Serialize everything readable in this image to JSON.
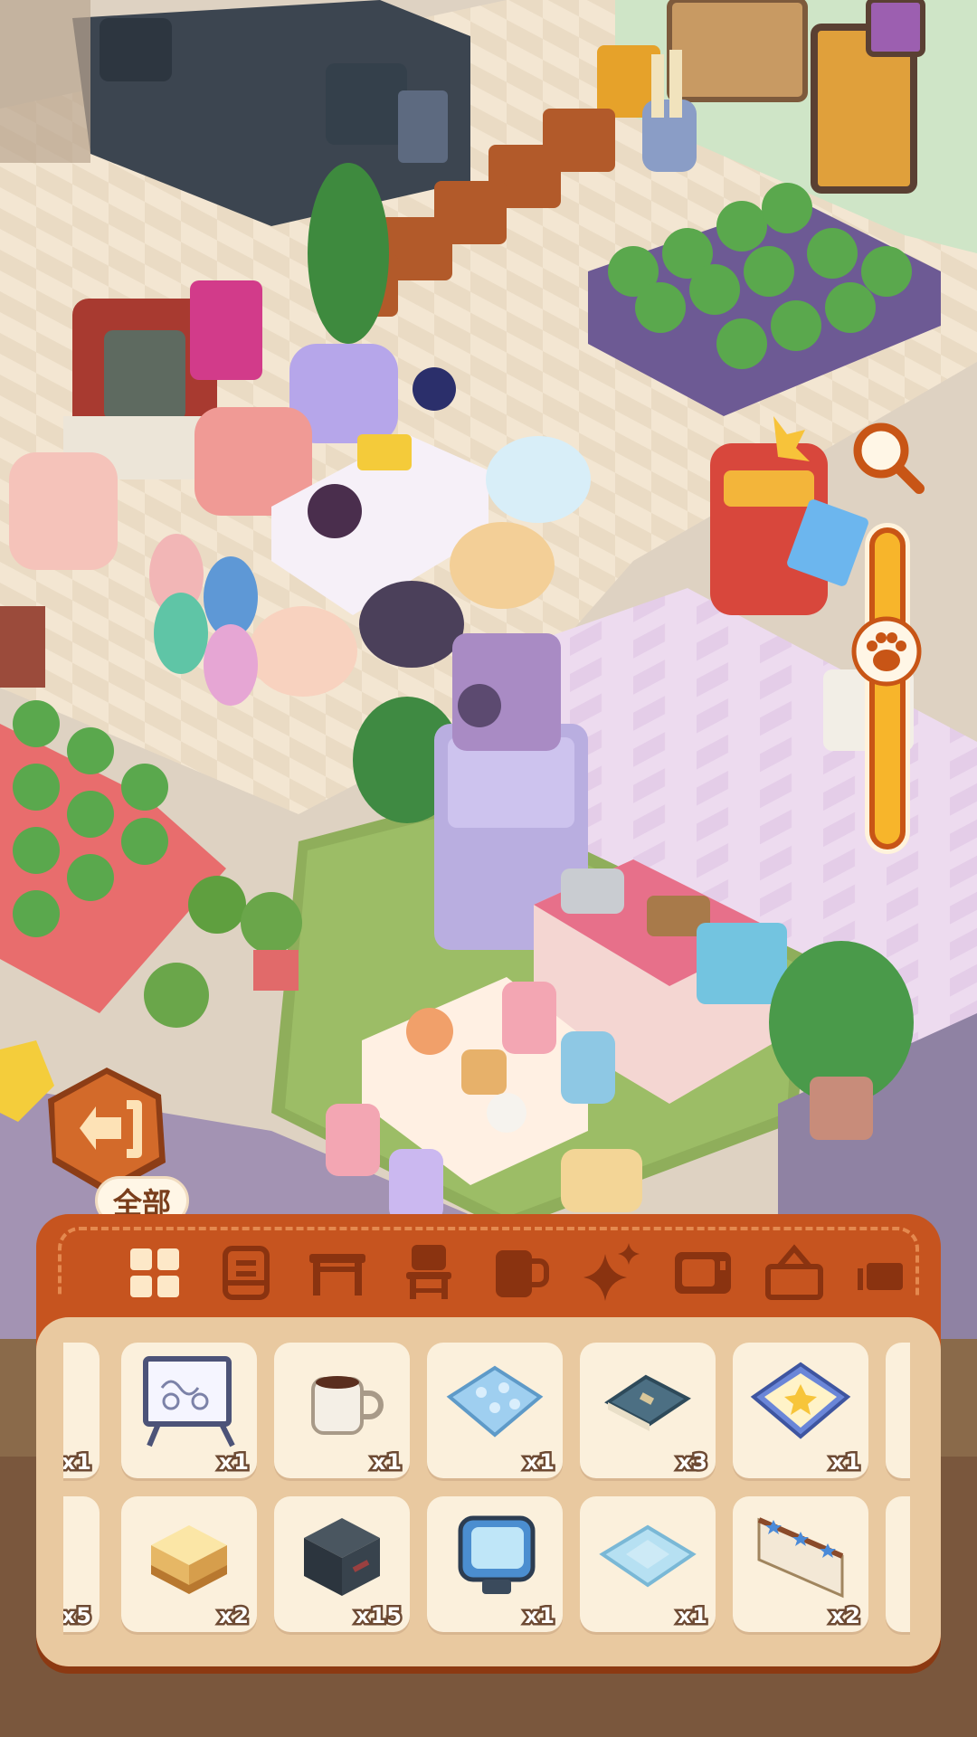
{
  "tooltip": {
    "label": "全部"
  },
  "tabs": [
    {
      "id": "all",
      "icon": "grid-icon",
      "selected": true
    },
    {
      "id": "cabinet",
      "icon": "cabinet-icon",
      "selected": false
    },
    {
      "id": "table",
      "icon": "table-icon",
      "selected": false
    },
    {
      "id": "chair",
      "icon": "chair-icon",
      "selected": false
    },
    {
      "id": "cup",
      "icon": "cup-icon",
      "selected": false
    },
    {
      "id": "sparkle",
      "icon": "sparkle-icon",
      "selected": false
    },
    {
      "id": "appliance",
      "icon": "appliance-icon",
      "selected": false
    },
    {
      "id": "frame",
      "icon": "frame-icon",
      "selected": false
    },
    {
      "id": "more",
      "icon": "more-icon",
      "selected": false
    }
  ],
  "inventory": {
    "row1": [
      {
        "name": "partial-item",
        "count": "x1",
        "icon": "partial-icon"
      },
      {
        "name": "whiteboard",
        "count": "x1",
        "icon": "whiteboard-icon"
      },
      {
        "name": "coffee-mug",
        "count": "x1",
        "icon": "mug-icon"
      },
      {
        "name": "blue-dotted-cushion",
        "count": "x1",
        "icon": "cushion-icon"
      },
      {
        "name": "book",
        "count": "x3",
        "icon": "book-icon"
      },
      {
        "name": "star-cushion",
        "count": "x1",
        "icon": "star-cushion-icon"
      },
      {
        "name": "partial-item-right",
        "count": "",
        "icon": "partial-icon"
      }
    ],
    "row2": [
      {
        "name": "partial-item",
        "count": "x5",
        "icon": "partial-icon"
      },
      {
        "name": "pudding-stool",
        "count": "x2",
        "icon": "stool-icon"
      },
      {
        "name": "dark-cube",
        "count": "x15",
        "icon": "cube-icon"
      },
      {
        "name": "blue-monitor",
        "count": "x1",
        "icon": "monitor-icon"
      },
      {
        "name": "light-blue-cushion",
        "count": "x1",
        "icon": "cushion-icon"
      },
      {
        "name": "star-fence",
        "count": "x2",
        "icon": "fence-icon"
      },
      {
        "name": "partial-item-right",
        "count": "",
        "icon": "partial-icon"
      }
    ]
  },
  "colors": {
    "panel": "#c6541f",
    "grid_bg": "#e9c9a0",
    "cell_bg": "#fbf0dc",
    "accent": "#f7b52b"
  },
  "zoom": {
    "level": 0.3
  }
}
